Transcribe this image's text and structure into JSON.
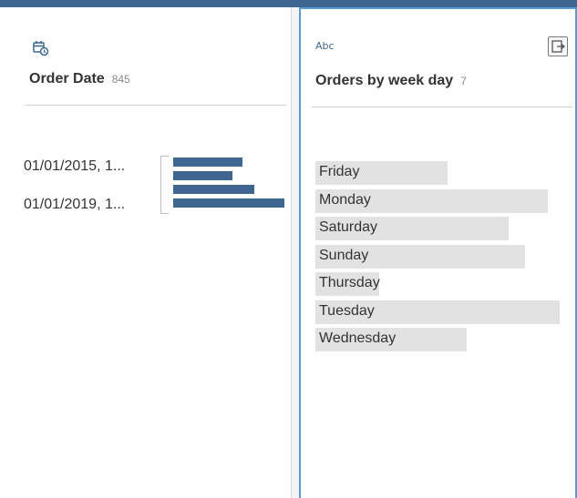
{
  "left_field": {
    "type_icon": "calendar-clock-icon",
    "name": "Order Date",
    "count": "845",
    "date_labels": [
      "01/01/2015, 1...",
      "01/01/2019, 1..."
    ],
    "histogram_values": [
      0.62,
      0.53,
      0.73,
      1.0
    ]
  },
  "right_field": {
    "type_label": "Abc",
    "name": "Orders by week day",
    "count": "7",
    "export_icon": "export-icon",
    "values": [
      {
        "label": "Friday",
        "fraction": 0.54
      },
      {
        "label": "Monday",
        "fraction": 0.95
      },
      {
        "label": "Saturday",
        "fraction": 0.79
      },
      {
        "label": "Sunday",
        "fraction": 0.86
      },
      {
        "label": "Thursday",
        "fraction": 0.26
      },
      {
        "label": "Tuesday",
        "fraction": 1.0
      },
      {
        "label": "Wednesday",
        "fraction": 0.62
      }
    ]
  },
  "colors": {
    "accent": "#3f6690",
    "selection_border": "#5b9bd5",
    "value_fill": "#e2e2e2"
  }
}
